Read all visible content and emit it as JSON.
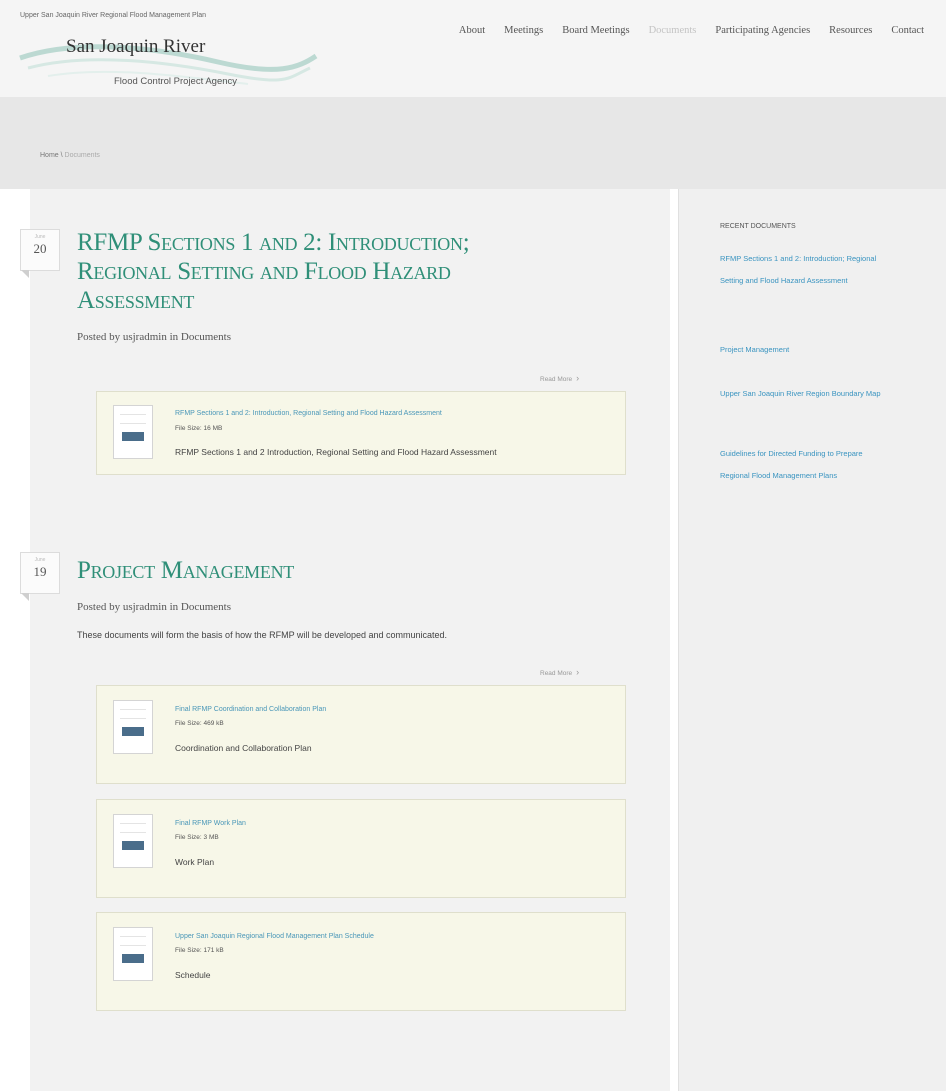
{
  "site": {
    "tagline": "Upper San Joaquin River Regional Flood Management Plan",
    "logo_title": "San Joaquin River",
    "logo_subtitle": "Flood Control Project Agency"
  },
  "nav": {
    "items": [
      "About",
      "Meetings",
      "Board Meetings",
      "Documents",
      "Participating Agencies",
      "Resources",
      "Contact"
    ],
    "active": "Documents"
  },
  "breadcrumb": {
    "home": "Home",
    "separator": " \\ ",
    "current": "Documents"
  },
  "posts": [
    {
      "month": "June",
      "day": "20",
      "title_lines": [
        "RFMP Sections 1 and 2: Introduction;",
        "Regional Setting and Flood Hazard",
        "Assessment"
      ],
      "meta": "Posted by usjradmin in Documents",
      "excerpt": "",
      "read_more": "Read More",
      "documents": [
        {
          "link": "RFMP Sections 1 and 2: Introduction, Regional Setting and Flood Hazard Assessment",
          "size": "File Size: 16 MB",
          "description": "RFMP Sections 1 and 2 Introduction, Regional Setting and Flood Hazard Assessment"
        }
      ]
    },
    {
      "month": "June",
      "day": "19",
      "title_lines": [
        "Project Management"
      ],
      "meta": "Posted by usjradmin in Documents",
      "excerpt": "These documents will form the basis of how the RFMP will be developed and communicated.",
      "read_more": "Read More",
      "documents": [
        {
          "link": "Final RFMP Coordination and Collaboration Plan",
          "size": "File Size: 469 kB",
          "description": "Coordination and Collaboration Plan"
        },
        {
          "link": "Final RFMP Work Plan",
          "size": "File Size: 3 MB",
          "description": "Work Plan"
        },
        {
          "link": "Upper San Joaquin Regional Flood Management Plan Schedule",
          "size": "File Size: 171 kB",
          "description": "Schedule"
        }
      ]
    }
  ],
  "sidebar": {
    "heading": "RECENT DOCUMENTS",
    "links": [
      "RFMP Sections 1 and 2: Introduction; Regional Setting and Flood Hazard Assessment",
      "Project Management",
      "Upper San Joaquin River Region Boundary Map",
      "Guidelines for Directed Funding to Prepare Regional Flood Management Plans"
    ]
  },
  "colors": {
    "title_green": "#2f8f78",
    "link_blue": "#3a94c0",
    "doc_box_bg": "#f7f7e8"
  }
}
